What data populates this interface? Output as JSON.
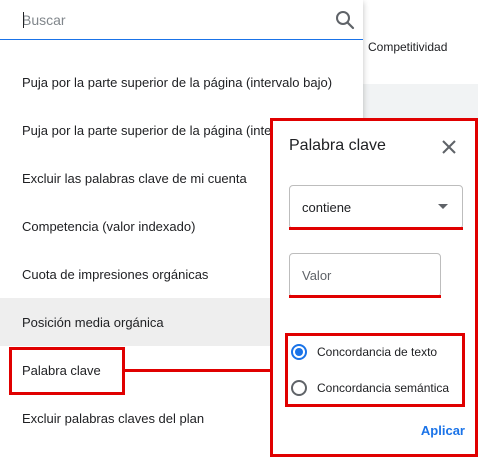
{
  "background": {
    "column_header": "Competitividad"
  },
  "search": {
    "placeholder": "Buscar",
    "icon": "search-icon"
  },
  "list": {
    "items": [
      {
        "label": "Puja por la parte superior de la página (intervalo bajo)"
      },
      {
        "label": "Puja por la parte superior de la página (intervalo alto)"
      },
      {
        "label": "Excluir las palabras clave de mi cuenta"
      },
      {
        "label": "Competencia (valor indexado)"
      },
      {
        "label": "Cuota de impresiones orgánicas"
      },
      {
        "label": "Posición media orgánica"
      },
      {
        "label": "Palabra clave"
      },
      {
        "label": "Excluir palabras claves del plan"
      }
    ],
    "hovered_index": 5,
    "highlighted_index": 6
  },
  "panel": {
    "title": "Palabra clave",
    "operator": "contiene",
    "value_placeholder": "Valor",
    "options": [
      {
        "label": "Concordancia de texto",
        "checked": true
      },
      {
        "label": "Concordancia semántica",
        "checked": false
      }
    ],
    "apply_label": "Aplicar"
  },
  "colors": {
    "accent": "#1a73e8",
    "highlight": "#e00000",
    "hover": "#eeeeee"
  }
}
